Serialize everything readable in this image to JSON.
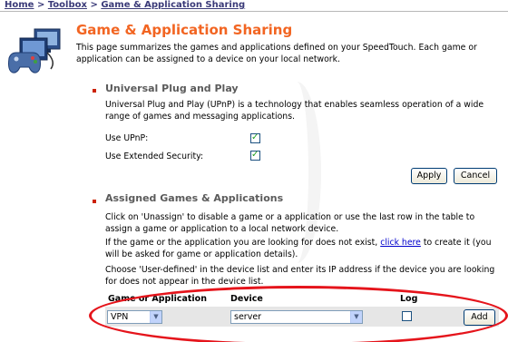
{
  "breadcrumb": {
    "home": "Home",
    "sep1": ">",
    "toolbox": "Toolbox",
    "sep2": ">",
    "current": "Game & Application Sharing"
  },
  "page": {
    "title": "Game & Application Sharing",
    "intro": "This page summarizes the games and applications defined on your SpeedTouch. Each game or application can be assigned to a device on your local network."
  },
  "upnp": {
    "heading": "Universal Plug and Play",
    "description": "Universal Plug and Play (UPnP) is a technology that enables seamless operation of a wide range of games and messaging applications.",
    "use_upnp_label": "Use UPnP:",
    "use_upnp_checked": true,
    "ext_security_label": "Use Extended Security:",
    "ext_security_checked": true,
    "apply_label": "Apply",
    "cancel_label": "Cancel"
  },
  "assigned": {
    "heading": "Assigned Games & Applications",
    "para1": "Click on 'Unassign' to disable a game or a application or use the last row in the table to assign a game or application to a local network device.",
    "para2_before": "If the game or the application you are looking for does not exist, ",
    "para2_link": "click here",
    "para2_after": " to create it (you will be asked for game or application details).",
    "para3": "Choose 'User-defined' in the device list and enter its IP address if the device you are looking for does not appear in the device list.",
    "table": {
      "col_app": "Game or Application",
      "col_device": "Device",
      "col_log": "Log",
      "row": {
        "app_value": "VPN",
        "device_value": "server",
        "log_checked": false,
        "add_label": "Add"
      }
    }
  },
  "colors": {
    "title": "#f26522",
    "annotation": "#e5141b",
    "link": "#0000cc"
  }
}
